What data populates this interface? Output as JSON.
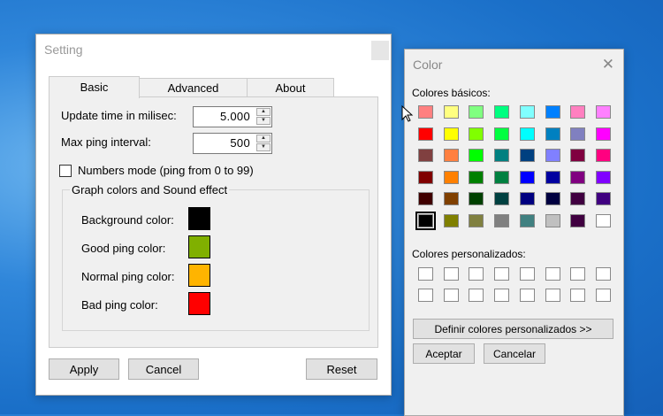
{
  "setting": {
    "title": "Setting",
    "tabs": [
      {
        "label": "Basic"
      },
      {
        "label": "Advanced"
      },
      {
        "label": "About"
      }
    ],
    "update_time": {
      "label": "Update time in milisec:",
      "value": "5.000"
    },
    "max_ping": {
      "label": "Max ping interval:",
      "value": "500"
    },
    "numbers_mode": {
      "label": "Numbers mode (ping from 0 to 99)",
      "checked": false
    },
    "group": {
      "title": "Graph colors and Sound effect",
      "items": [
        {
          "label": "Background color:",
          "color": "#000000"
        },
        {
          "label": "Good ping color:",
          "color": "#80b000"
        },
        {
          "label": "Normal ping color:",
          "color": "#ffb400"
        },
        {
          "label": "Bad ping color:",
          "color": "#ff0000"
        }
      ]
    },
    "buttons": {
      "apply": "Apply",
      "cancel": "Cancel",
      "reset": "Reset"
    }
  },
  "color_dialog": {
    "title": "Color",
    "basic_label": "Colores básicos:",
    "custom_label": "Colores personalizados:",
    "basic_colors": [
      [
        "#ff8080",
        "#ffff80",
        "#80ff80",
        "#00ff80",
        "#80ffff",
        "#0080ff",
        "#ff80c0",
        "#ff80ff"
      ],
      [
        "#ff0000",
        "#ffff00",
        "#80ff00",
        "#00ff40",
        "#00ffff",
        "#0080c0",
        "#8080c0",
        "#ff00ff"
      ],
      [
        "#804040",
        "#ff8040",
        "#00ff00",
        "#008080",
        "#004080",
        "#8080ff",
        "#800040",
        "#ff0080"
      ],
      [
        "#800000",
        "#ff8000",
        "#008000",
        "#008040",
        "#0000ff",
        "#0000a0",
        "#800080",
        "#8000ff"
      ],
      [
        "#400000",
        "#804000",
        "#004000",
        "#004040",
        "#000080",
        "#000040",
        "#400040",
        "#400080"
      ],
      [
        "#000000",
        "#808000",
        "#808040",
        "#808080",
        "#408080",
        "#c0c0c0",
        "#400040",
        "#ffffff"
      ]
    ],
    "selected": [
      5,
      0
    ],
    "define_custom": "Definir colores personalizados >>",
    "ok": "Aceptar",
    "cancel": "Cancelar"
  }
}
